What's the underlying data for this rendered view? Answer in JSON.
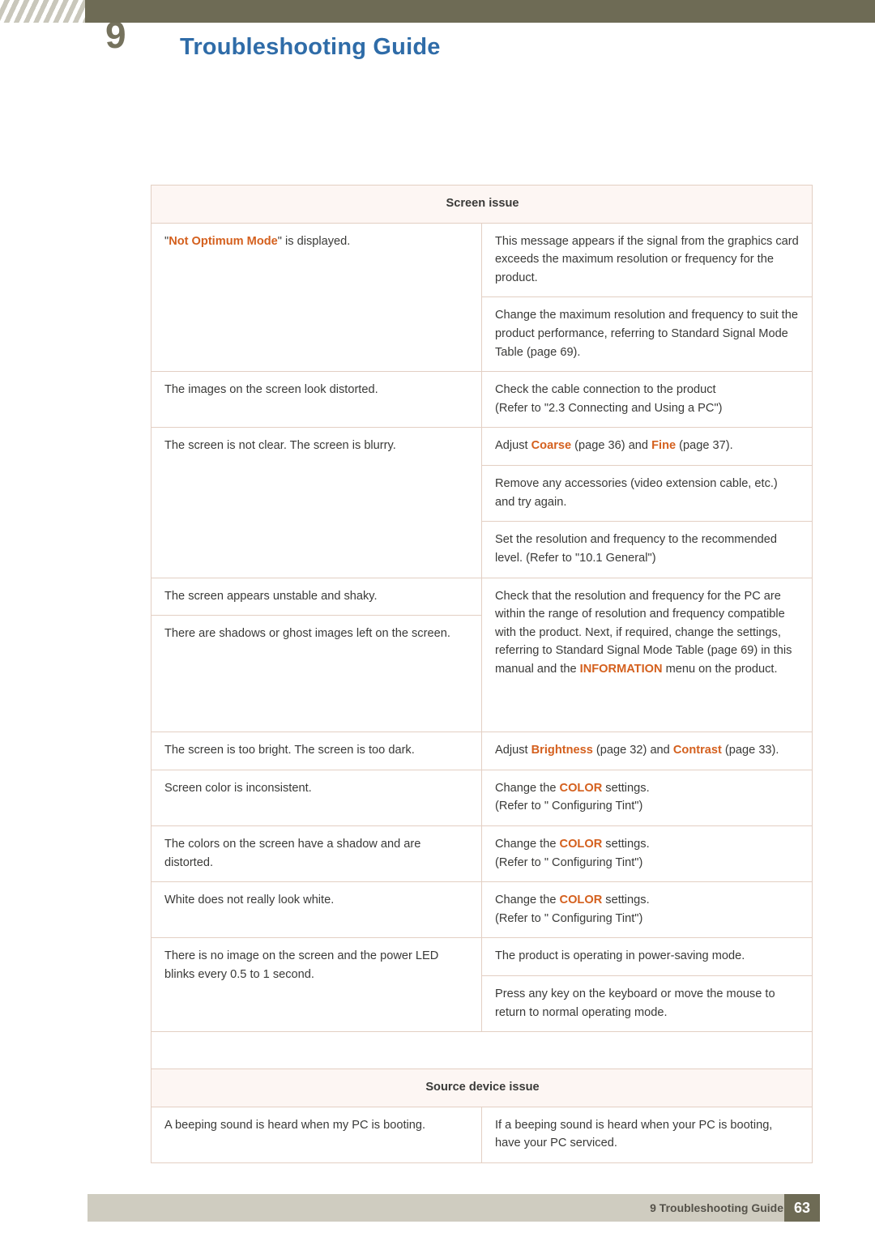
{
  "header": {
    "chapter_number": "9",
    "title": "Troubleshooting Guide"
  },
  "sections": [
    {
      "heading": "Screen issue",
      "rows": [
        {
          "left": "\"Not Optimum Mode\" is displayed.",
          "left_highlight": "Not Optimum Mode",
          "right": [
            "This message appears if the signal from the graphics card exceeds the maximum resolution or frequency for the product.",
            "Change the maximum resolution and frequency to suit the product performance, referring to Standard Signal Mode Table (page 69)."
          ]
        },
        {
          "left": "The images on the screen look distorted.",
          "right": [
            "Check the cable connection to the product\n(Refer to \"2.3 Connecting and Using a PC\")"
          ]
        },
        {
          "left": "The screen is not clear. The screen is blurry.",
          "right": [
            "Adjust Coarse (page 36) and Fine (page 37).",
            "Remove any accessories (video extension cable, etc.) and try again.",
            "Set the resolution and frequency to the recommended level. (Refer to \"10.1 General\")"
          ]
        },
        {
          "left": "The screen appears unstable and shaky.",
          "left2": "There are shadows or ghost images left on the screen.",
          "right": [
            "Check that the resolution and frequency for the PC are within the range of resolution and frequency compatible with the product. Next, if required, change the settings, referring to Standard Signal Mode Table (page 69) in this manual and the INFORMATION menu on the product."
          ]
        },
        {
          "left": "The screen is too bright. The screen is too dark.",
          "right": [
            "Adjust Brightness (page 32) and Contrast (page 33)."
          ]
        },
        {
          "left": "Screen color is inconsistent.",
          "right": [
            "Change the COLOR settings.\n(Refer to \" Configuring Tint\")"
          ]
        },
        {
          "left": "The colors on the screen have a shadow and are distorted.",
          "right": [
            "Change the COLOR settings.\n(Refer to \" Configuring Tint\")"
          ]
        },
        {
          "left": "White does not really look white.",
          "right": [
            "Change the COLOR settings.\n(Refer to \" Configuring Tint\")"
          ]
        },
        {
          "left": "There is no image on the screen and the power LED blinks every 0.5 to 1 second.",
          "right": [
            "The product is operating in power-saving mode.",
            "Press any key on the keyboard or move the mouse to return to normal operating mode."
          ]
        }
      ]
    },
    {
      "heading": "Source device issue",
      "rows": [
        {
          "left": "A beeping sound is heard when my PC is booting.",
          "right": [
            "If a beeping sound is heard when your PC is booting, have your PC serviced."
          ]
        }
      ]
    }
  ],
  "text_fragments": {
    "not_optimum_mode": "Not Optimum Mode",
    "quote_open": "\"",
    "quote_close": "\"",
    "is_displayed": " is displayed.",
    "coarse": "Coarse",
    "fine": "Fine",
    "adjust_prefix": "Adjust ",
    "coarse_mid": " (page 36) and ",
    "fine_suffix": " (page 37).",
    "information": "INFORMATION",
    "brightness": "Brightness",
    "contrast": "Contrast",
    "adjust_bright_mid": " (page 32) and ",
    "contrast_suffix": " (page",
    "contrast_line2": "33).",
    "color": "COLOR",
    "change_the": "Change the ",
    "settings_suffix": " settings.",
    "refer_tint": "(Refer to \" Configuring Tint\")",
    "shadow_part1": "manual and the ",
    "shadow_part2": " menu on the",
    "shadow_part3": "product."
  },
  "footer": {
    "label": "9 Troubleshooting Guide",
    "page": "63"
  }
}
